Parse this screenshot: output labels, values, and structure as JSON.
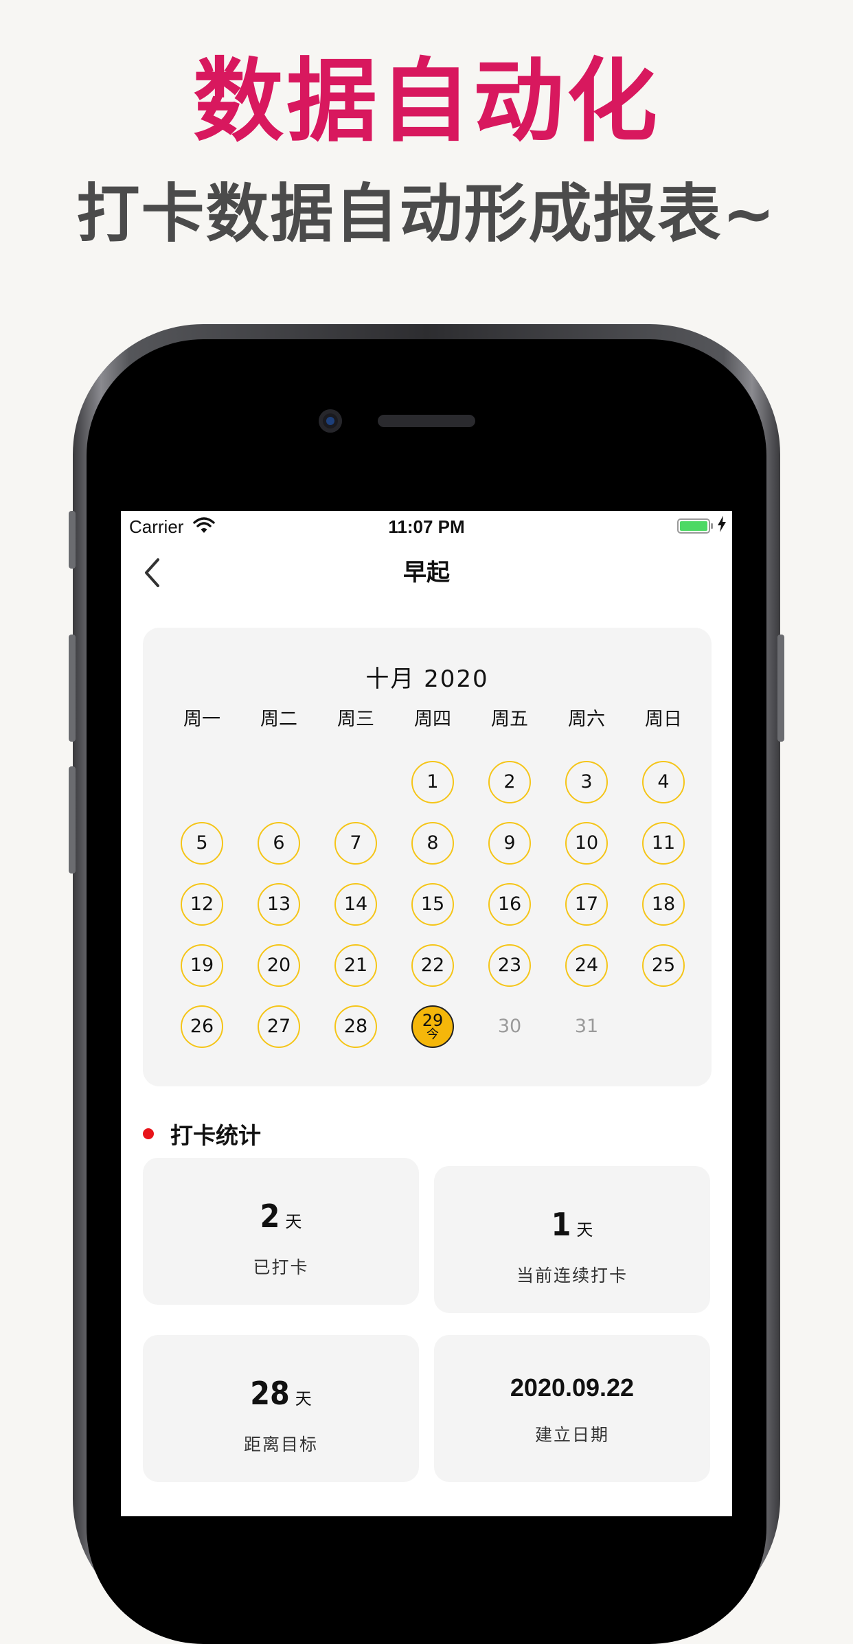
{
  "promo": {
    "headline": "数据自动化",
    "subline": "打卡数据自动形成报表~"
  },
  "status_bar": {
    "carrier": "Carrier",
    "time": "11:07 PM"
  },
  "nav": {
    "title": "早起"
  },
  "calendar": {
    "month_title": "十月  2020",
    "weekdays": [
      "周一",
      "周二",
      "周三",
      "周四",
      "周五",
      "周六",
      "周日"
    ],
    "days": [
      {
        "day": "",
        "state": "empty"
      },
      {
        "day": "",
        "state": "empty"
      },
      {
        "day": "",
        "state": "empty"
      },
      {
        "day": "1",
        "state": "past"
      },
      {
        "day": "2",
        "state": "past"
      },
      {
        "day": "3",
        "state": "past"
      },
      {
        "day": "4",
        "state": "past"
      },
      {
        "day": "5",
        "state": "past"
      },
      {
        "day": "6",
        "state": "past"
      },
      {
        "day": "7",
        "state": "past"
      },
      {
        "day": "8",
        "state": "past"
      },
      {
        "day": "9",
        "state": "past"
      },
      {
        "day": "10",
        "state": "past"
      },
      {
        "day": "11",
        "state": "past"
      },
      {
        "day": "12",
        "state": "past"
      },
      {
        "day": "13",
        "state": "past"
      },
      {
        "day": "14",
        "state": "past"
      },
      {
        "day": "15",
        "state": "past"
      },
      {
        "day": "16",
        "state": "past"
      },
      {
        "day": "17",
        "state": "past"
      },
      {
        "day": "18",
        "state": "past"
      },
      {
        "day": "19",
        "state": "past"
      },
      {
        "day": "20",
        "state": "past"
      },
      {
        "day": "21",
        "state": "past"
      },
      {
        "day": "22",
        "state": "past"
      },
      {
        "day": "23",
        "state": "past"
      },
      {
        "day": "24",
        "state": "past"
      },
      {
        "day": "25",
        "state": "past"
      },
      {
        "day": "26",
        "state": "past"
      },
      {
        "day": "27",
        "state": "past"
      },
      {
        "day": "28",
        "state": "past"
      },
      {
        "day": "29",
        "state": "today",
        "mark": "今"
      },
      {
        "day": "30",
        "state": "future"
      },
      {
        "day": "31",
        "state": "future"
      }
    ]
  },
  "stats": {
    "section_title": "打卡统计",
    "checked_in": {
      "value": "2",
      "unit": "天",
      "label": "已打卡"
    },
    "current_streak": {
      "value": "1",
      "unit": "天",
      "label": "当前连续打卡"
    },
    "days_to_goal": {
      "value": "28",
      "unit": "天",
      "label": "距离目标"
    },
    "created_date": {
      "value": "2020.09.22",
      "label": "建立日期"
    }
  },
  "colors": {
    "headline": "#d8185e",
    "subline": "#4b4b4b",
    "day_ring": "#f5c518",
    "today_fill": "#f5b70a",
    "section_dot": "#e8141a",
    "card_bg": "#f4f4f4"
  }
}
